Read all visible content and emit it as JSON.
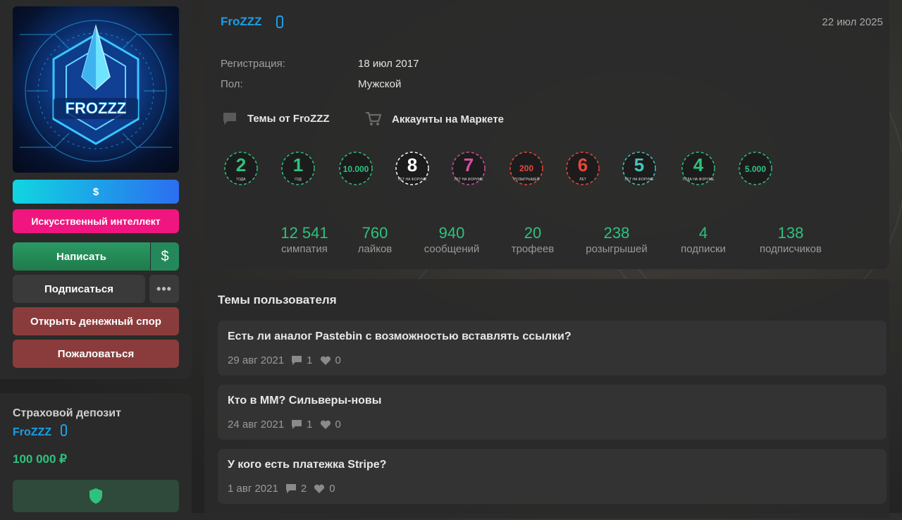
{
  "sidebar": {
    "buttons": {
      "dollar": "$",
      "ai": "Искусственный интеллект",
      "write": "Написать",
      "write_dollar": "$",
      "subscribe": "Подписаться",
      "more": "•••",
      "dispute": "Открыть денежный спор",
      "report": "Пожаловаться"
    },
    "avatar_text": "FROZZZ",
    "deposit": {
      "title": "Страховой депозит",
      "name": "FroZZZ",
      "amount": "100 000 ₽",
      "icon": "shield-icon"
    }
  },
  "profile": {
    "username": "FroZZZ",
    "date": "22 июл 2025",
    "info": [
      {
        "label": "Регистрация:",
        "value": "18 июл 2017"
      },
      {
        "label": "Пол:",
        "value": "Мужской"
      }
    ],
    "links": [
      {
        "icon": "chat-icon",
        "label": "Темы от FroZZZ"
      },
      {
        "icon": "cart-icon",
        "label": "Аккаунты на Маркете"
      }
    ],
    "trophies": [
      {
        "main": "2",
        "sub": "ГОДА",
        "color": "#2ec27e"
      },
      {
        "main": "1",
        "sub": "ГОД",
        "color": "#2ec27e"
      },
      {
        "main": "10.000",
        "sub": "",
        "color": "#2ec27e"
      },
      {
        "main": "8",
        "sub": "ЛЕТ НА ФОРУМЕ",
        "color": "#ffffff"
      },
      {
        "main": "7",
        "sub": "ЛЕТ НА ФОРУМЕ",
        "color": "#d64fa0"
      },
      {
        "main": "200",
        "sub": "РОЗЫГРЫШЕЙ",
        "color": "#e8473b"
      },
      {
        "main": "6",
        "sub": "ЛЕТ",
        "color": "#e8473b"
      },
      {
        "main": "5",
        "sub": "ЛЕТ НА ФОРУМЕ",
        "color": "#46c6b8"
      },
      {
        "main": "4",
        "sub": "ГОДА НА ФОРУМЕ",
        "color": "#2ec27e"
      },
      {
        "main": "5.000",
        "sub": "",
        "color": "#2ec27e"
      }
    ],
    "stats": [
      {
        "value": "12 541",
        "label": "симпатия"
      },
      {
        "value": "760",
        "label": "лайков"
      },
      {
        "value": "940",
        "label": "сообщений"
      },
      {
        "value": "20",
        "label": "трофеев"
      },
      {
        "value": "238",
        "label": "розыгрышей"
      },
      {
        "value": "4",
        "label": "подписки"
      },
      {
        "value": "138",
        "label": "подписчиков"
      }
    ]
  },
  "threads": {
    "title": "Темы пользователя",
    "items": [
      {
        "title": "Есть ли аналог Pastebin с возможностью вставлять ссылки?",
        "date": "29 авг 2021",
        "replies": "1",
        "likes": "0"
      },
      {
        "title": "Кто в ММ? Сильверы-новы",
        "date": "24 авг 2021",
        "replies": "1",
        "likes": "0"
      },
      {
        "title": "У кого есть платежка Stripe?",
        "date": "1 авг 2021",
        "replies": "2",
        "likes": "0"
      }
    ]
  }
}
